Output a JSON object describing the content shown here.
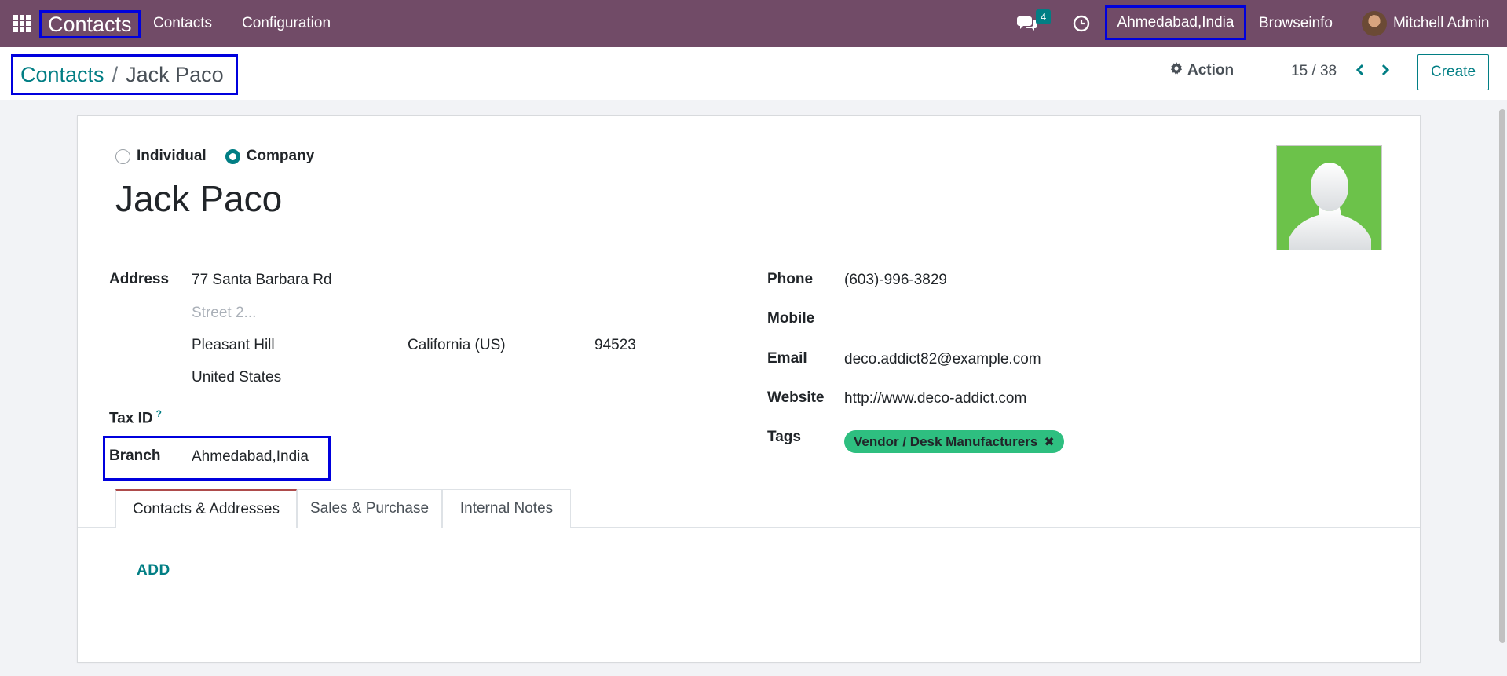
{
  "navbar": {
    "app_name": "Contacts",
    "menu": [
      {
        "label": "Contacts"
      },
      {
        "label": "Configuration"
      }
    ],
    "chat_badge_count": "4",
    "current_company": "Ahmedabad,India",
    "company_name": "Browseinfo",
    "user_name": "Mitchell Admin",
    "icons": [
      "apps-grid-icon",
      "chat-icon",
      "clock-icon"
    ]
  },
  "breadcrumb": {
    "parent": "Contacts",
    "separator": "/",
    "current": "Jack Paco"
  },
  "control_panel": {
    "action_label": "Action",
    "pager": "15 / 38",
    "create_label": "Create"
  },
  "form": {
    "company_type": {
      "options": [
        "Individual",
        "Company"
      ],
      "selected": "Company"
    },
    "name": "Jack Paco",
    "address": {
      "label": "Address",
      "street": "77 Santa Barbara Rd",
      "street2_placeholder": "Street 2...",
      "city": "Pleasant Hill",
      "state": "California (US)",
      "zip": "94523",
      "country": "United States"
    },
    "tax_id": {
      "label": "Tax ID",
      "help": "?",
      "value": ""
    },
    "branch": {
      "label": "Branch",
      "value": "Ahmedabad,India"
    },
    "phone": {
      "label": "Phone",
      "value": "(603)-996-3829"
    },
    "mobile": {
      "label": "Mobile",
      "value": ""
    },
    "email": {
      "label": "Email",
      "value": "deco.addict82@example.com"
    },
    "website": {
      "label": "Website",
      "value": "http://www.deco-addict.com"
    },
    "tags": {
      "label": "Tags",
      "items": [
        "Vendor / Desk Manufacturers"
      ]
    },
    "tabs": [
      {
        "label": "Contacts & Addresses",
        "active": true
      },
      {
        "label": "Sales & Purchase",
        "active": false
      },
      {
        "label": "Internal Notes",
        "active": false
      }
    ],
    "add_label": "ADD"
  },
  "colors": {
    "navbar": "#714b67",
    "accent": "#017e84",
    "tag": "#2ebf80",
    "highlight_box": "#0000dd"
  }
}
